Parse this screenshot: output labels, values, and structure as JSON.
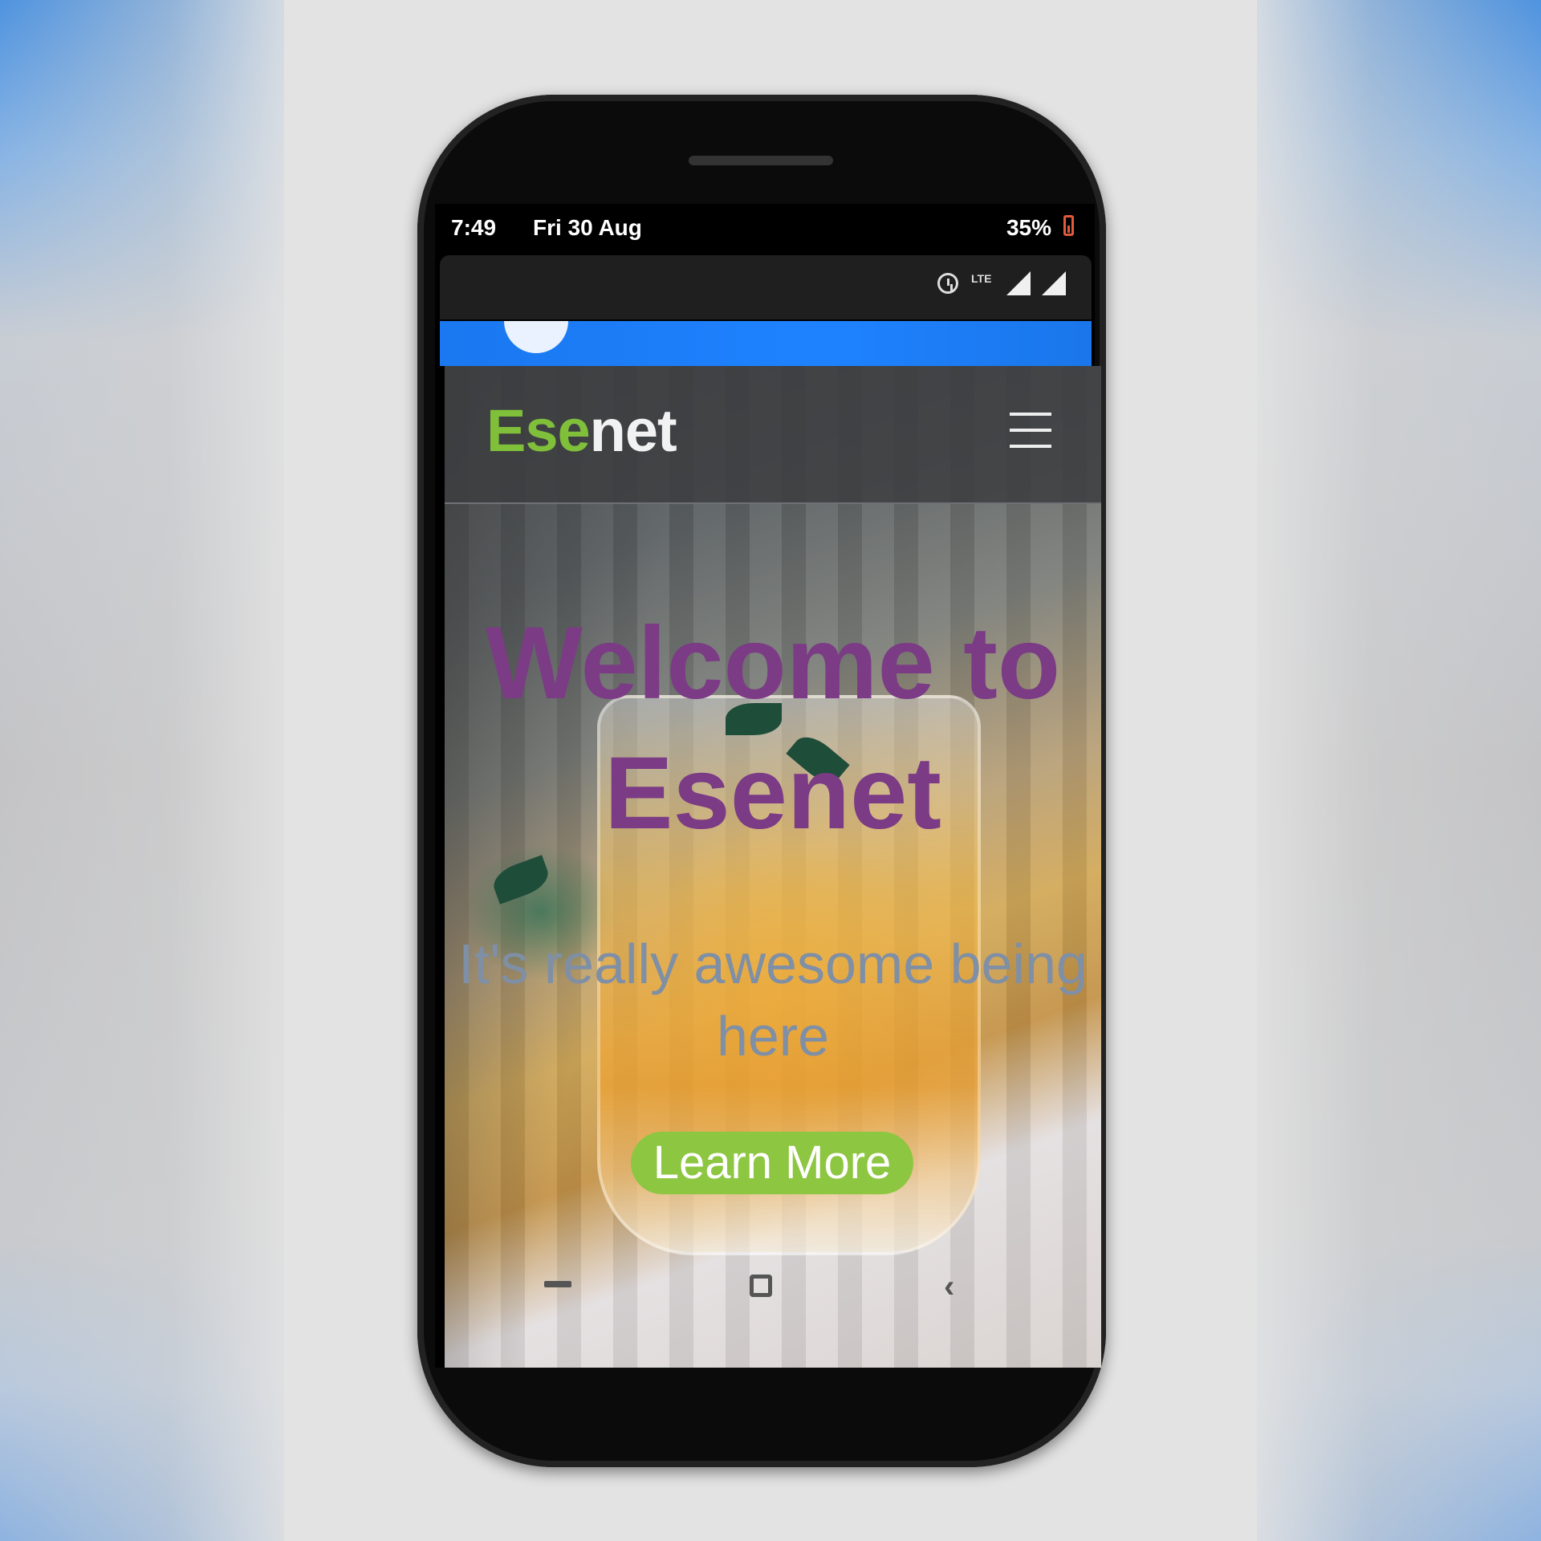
{
  "status_bar": {
    "time": "7:49",
    "date": "Fri 30 Aug",
    "battery": "35%"
  },
  "notification_icons": [
    "alarm-icon",
    "lte-icon",
    "signal-icon",
    "signal-icon"
  ],
  "lte_label": "LTE",
  "site": {
    "logo_part1": "Ese",
    "logo_part2": "net",
    "hero_title": "Welcome to Esenet",
    "hero_subtitle": "It's really awesome being here",
    "cta_label": "Learn More"
  },
  "colors": {
    "logo_green": "#7fbf3a",
    "title_purple": "#7b3b85",
    "subtitle_gray": "#7e8fa6",
    "button_green": "#8dc641",
    "app_blue": "#1e82ff"
  }
}
